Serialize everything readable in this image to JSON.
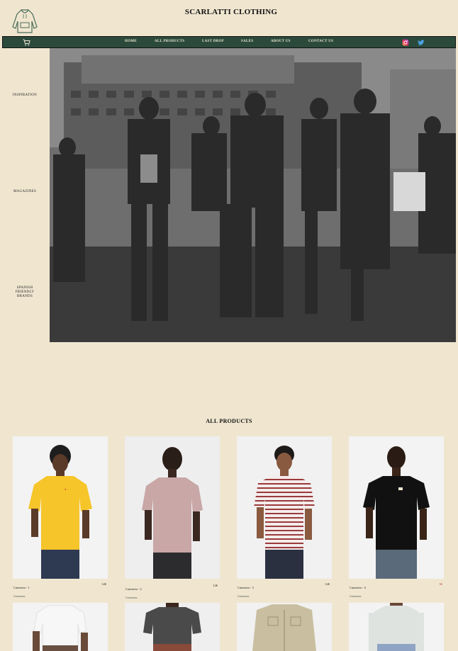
{
  "header": {
    "brand": "SCARLATTI CLOTHING"
  },
  "nav": {
    "items": [
      {
        "label": "HOME"
      },
      {
        "label": "ALL PRODUCTS"
      },
      {
        "label": "LAST DROP"
      },
      {
        "label": "SALES"
      },
      {
        "label": "ABOUT US"
      },
      {
        "label": "CONTACT US"
      }
    ],
    "icons": {
      "cart": "cart-icon",
      "instagram": "instagram-icon",
      "twitter": "twitter-icon"
    }
  },
  "sidebar": {
    "inspiration": "INSPIRATION",
    "magazines": "MAGAZINES",
    "spanish_line1": "SPANISH",
    "spanish_line2": "FRIENDLY",
    "spanish_line3": "BRANDS"
  },
  "products": {
    "title": "ALL PRODUCTS",
    "items": [
      {
        "name": "Camiseta - 1",
        "price": "12€",
        "category": "Camisetas"
      },
      {
        "name": "Camiseta - 2",
        "price": "12€",
        "category": "Camisetas"
      },
      {
        "name": "Camiseta - 3",
        "price": "12€",
        "category": "Camisetas"
      },
      {
        "name": "Camiseta - 4",
        "price": "5€",
        "category": "Camisetas"
      }
    ]
  },
  "colors": {
    "nav_bg": "#2b4a3c",
    "page_bg": "#f0e6d0",
    "sale_price": "#c0392b"
  }
}
